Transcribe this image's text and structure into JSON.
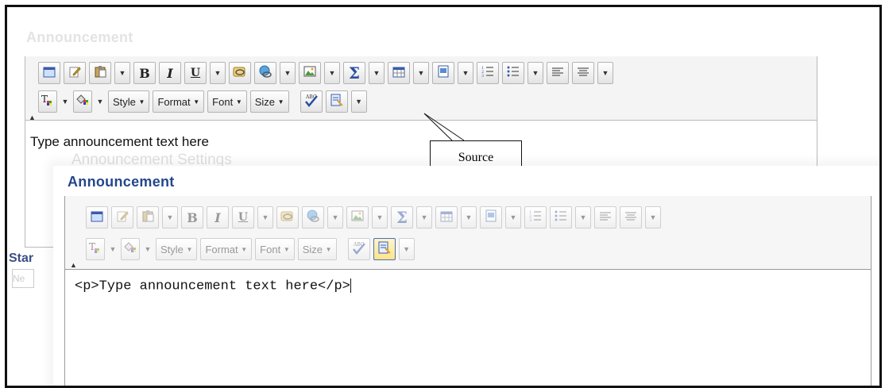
{
  "back_editor": {
    "section_heading": "Announcement",
    "faint_subheading": "Announcement Settings",
    "content_text": "Type announcement text here",
    "partial_label": "Star",
    "partial_field": "Ne"
  },
  "toolbar": {
    "bold": "B",
    "italic": "I",
    "underline": "U",
    "style_label": "Style",
    "format_label": "Format",
    "font_label": "Font",
    "size_label": "Size",
    "spell_label": "ABC"
  },
  "callout": {
    "label": "Source"
  },
  "front_editor": {
    "title": "Announcement",
    "source_code": "<p>Type announcement text here</p>"
  },
  "colors": {
    "title_blue": "#24478b",
    "active_button": "#ffe38a"
  }
}
